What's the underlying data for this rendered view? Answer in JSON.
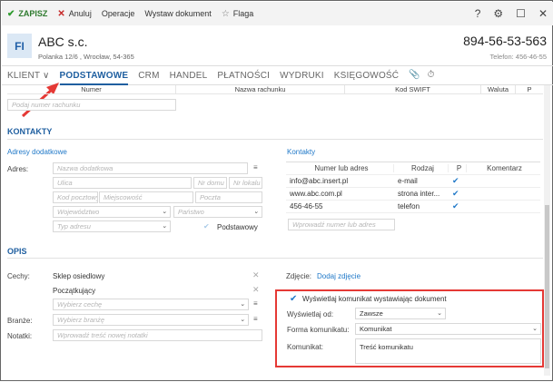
{
  "toolbar": {
    "save": "ZAPISZ",
    "cancel": "Anuluj",
    "operations": "Operacje",
    "issue": "Wystaw dokument",
    "flag": "Flaga"
  },
  "window": {
    "help": "?",
    "settings": "⚙",
    "maximize": "☐",
    "close": "✕"
  },
  "header": {
    "avatar": "FI",
    "name": "ABC s.c.",
    "address": "Polanka  12/6 , Wrocław, 54-365",
    "phone": "894-56-53-563",
    "phone2": "Telefon: 456-46-55"
  },
  "tabs": [
    {
      "label": "KLIENT ∨"
    },
    {
      "label": "PODSTAWOWE"
    },
    {
      "label": "CRM"
    },
    {
      "label": "HANDEL"
    },
    {
      "label": "PŁATNOŚCI"
    },
    {
      "label": "WYDRUKI"
    },
    {
      "label": "KSIĘGOWOŚĆ"
    }
  ],
  "bank": {
    "cols": [
      "Numer",
      "Nazwa rachunku",
      "Kod SWIFT",
      "Waluta",
      "P"
    ],
    "placeholder": "Podaj numer rachunku"
  },
  "kontakty": {
    "title": "KONTAKTY",
    "addr_title": "Adresy dodatkowe",
    "addr_label": "Adres:",
    "ph": {
      "name": "Nazwa dodatkowa",
      "street": "Ulica",
      "home": "Nr domu",
      "local": "Nr lokalu",
      "postal": "Kod pocztowy",
      "city": "Miejscowość",
      "post": "Poczta",
      "voiv": "Województwo",
      "country": "Państwo",
      "type": "Typ adresu"
    },
    "main_label": "Podstawowy",
    "contacts_title": "Kontakty",
    "cols": [
      "Numer lub adres",
      "Rodzaj",
      "P",
      "Komentarz"
    ],
    "rows": [
      {
        "num": "info@abc.insert.pl",
        "kind": "e-mail"
      },
      {
        "num": "www.abc.com.pl",
        "kind": "strona inter..."
      },
      {
        "num": "456-46-55",
        "kind": "telefon"
      }
    ],
    "new_ph": "Wprowadź numer lub adres"
  },
  "opis": {
    "title": "OPIS",
    "cechy_label": "Cechy:",
    "cechy": [
      "Sklep osiedlowy",
      "Początkujący"
    ],
    "cecha_ph": "Wybierz cechę",
    "branza_label": "Branże:",
    "branza_ph": "Wybierz branżę",
    "notes_label": "Notatki:",
    "notes_ph": "Wprowadź treść nowej notatki",
    "photo_label": "Zdjęcie:",
    "photo_link": "Dodaj zdjęcie"
  },
  "msg": {
    "show": "Wyświetlaj komunikat wystawiając dokument",
    "when_label": "Wyświetlaj od:",
    "when_value": "Zawsze",
    "form_label": "Forma komunikatu:",
    "form_value": "Komunikat",
    "text_label": "Komunikat:",
    "text_value": "Treść komunikatu"
  }
}
